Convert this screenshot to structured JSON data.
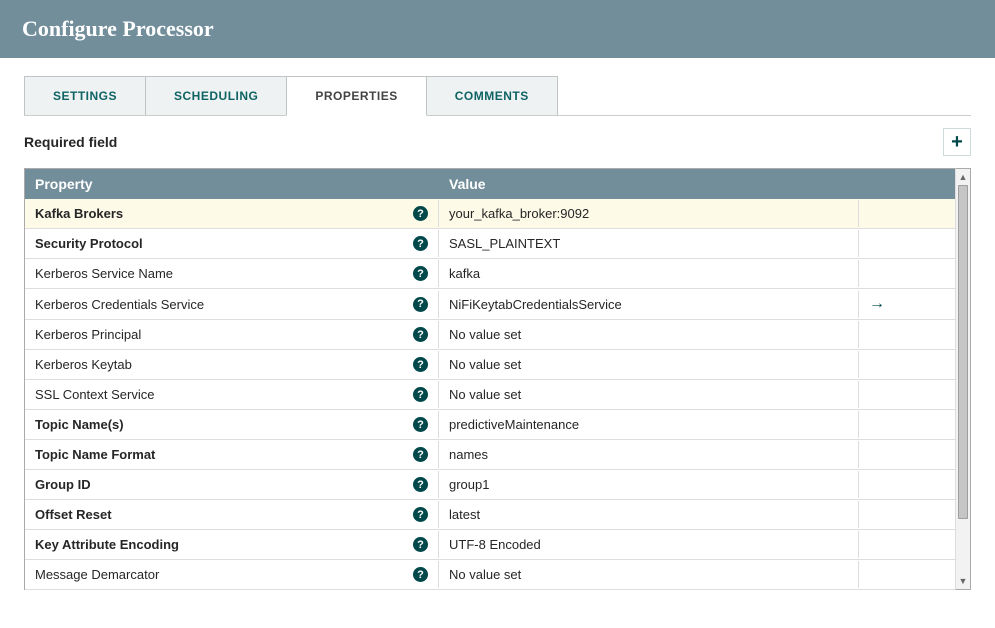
{
  "header": {
    "title": "Configure Processor"
  },
  "tabs": [
    {
      "label": "SETTINGS",
      "active": false
    },
    {
      "label": "SCHEDULING",
      "active": false
    },
    {
      "label": "PROPERTIES",
      "active": true
    },
    {
      "label": "COMMENTS",
      "active": false
    }
  ],
  "required_label": "Required field",
  "table": {
    "headers": {
      "property": "Property",
      "value": "Value"
    },
    "no_value_text": "No value set",
    "rows": [
      {
        "name": "Kafka Brokers",
        "value": "your_kafka_broker:9092",
        "bold": true,
        "no_value": false,
        "highlight": true,
        "goto": false
      },
      {
        "name": "Security Protocol",
        "value": "SASL_PLAINTEXT",
        "bold": true,
        "no_value": false,
        "highlight": false,
        "goto": false
      },
      {
        "name": "Kerberos Service Name",
        "value": "kafka",
        "bold": false,
        "no_value": false,
        "highlight": false,
        "goto": false
      },
      {
        "name": "Kerberos Credentials Service",
        "value": "NiFiKeytabCredentialsService",
        "bold": false,
        "no_value": false,
        "highlight": false,
        "goto": true
      },
      {
        "name": "Kerberos Principal",
        "value": "No value set",
        "bold": false,
        "no_value": true,
        "highlight": false,
        "goto": false
      },
      {
        "name": "Kerberos Keytab",
        "value": "No value set",
        "bold": false,
        "no_value": true,
        "highlight": false,
        "goto": false
      },
      {
        "name": "SSL Context Service",
        "value": "No value set",
        "bold": false,
        "no_value": true,
        "highlight": false,
        "goto": false
      },
      {
        "name": "Topic Name(s)",
        "value": "predictiveMaintenance",
        "bold": true,
        "no_value": false,
        "highlight": false,
        "goto": false
      },
      {
        "name": "Topic Name Format",
        "value": "names",
        "bold": true,
        "no_value": false,
        "highlight": false,
        "goto": false
      },
      {
        "name": "Group ID",
        "value": "group1",
        "bold": true,
        "no_value": false,
        "highlight": false,
        "goto": false
      },
      {
        "name": "Offset Reset",
        "value": "latest",
        "bold": true,
        "no_value": false,
        "highlight": false,
        "goto": false
      },
      {
        "name": "Key Attribute Encoding",
        "value": "UTF-8 Encoded",
        "bold": true,
        "no_value": false,
        "highlight": false,
        "goto": false
      },
      {
        "name": "Message Demarcator",
        "value": "No value set",
        "bold": false,
        "no_value": true,
        "highlight": false,
        "goto": false
      }
    ]
  }
}
